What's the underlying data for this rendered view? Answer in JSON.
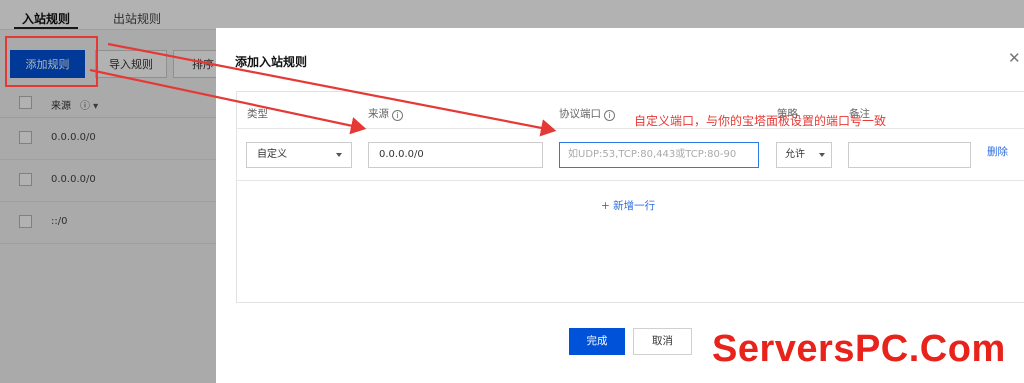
{
  "tabs": [
    "入站规则",
    "出站规则"
  ],
  "toolbar": {
    "add": "添加规则",
    "import": "导入规则",
    "sort": "排序"
  },
  "bg_table": {
    "header": "来源",
    "header_icons": "ⓘ ▾",
    "rows": [
      "0.0.0.0/0",
      "0.0.0.0/0",
      "::/0"
    ]
  },
  "dialog": {
    "title": "添加入站规则",
    "close_icon": "close-icon",
    "columns": {
      "type": "类型",
      "source": "来源",
      "port": "协议端口",
      "policy": "策略",
      "note": "备注"
    },
    "row": {
      "type_value": "自定义",
      "source_value": "0.0.0.0/0",
      "port_placeholder": "如UDP:53,TCP:80,443或TCP:80-90",
      "policy_value": "允许",
      "note_value": "",
      "delete": "删除"
    },
    "add_row": "+ 新增一行",
    "annotation": "自定义端口，与你的宝塔面板设置的端口号一致",
    "ok": "完成",
    "cancel": "取消"
  },
  "watermark": "ServersPC.Com",
  "colors": {
    "primary": "#0052d9",
    "annotation": "#e53935",
    "link": "#2c6cdf"
  }
}
